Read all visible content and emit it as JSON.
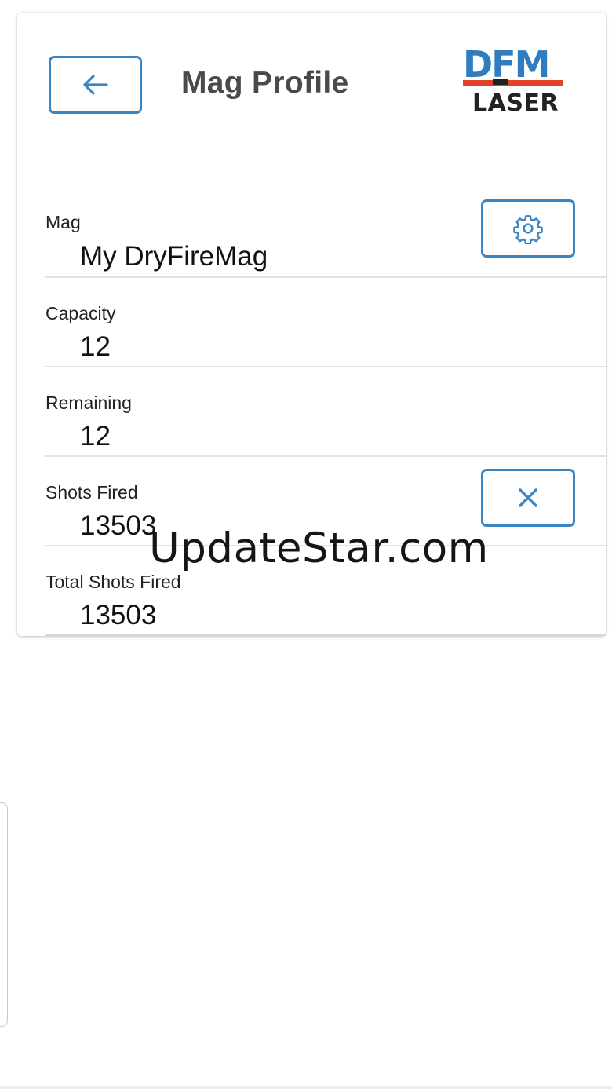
{
  "header": {
    "title": "Mag Profile",
    "back_icon": "arrow-left-icon"
  },
  "logo": {
    "text_top": "DFM",
    "text_bottom": "LASER",
    "colors": {
      "blue": "#2f7cc0",
      "red": "#e0432a",
      "dark": "#222222"
    }
  },
  "fields": {
    "mag": {
      "label": "Mag",
      "value": "My DryFireMag"
    },
    "capacity": {
      "label": "Capacity",
      "value": "12"
    },
    "remaining": {
      "label": "Remaining",
      "value": "12"
    },
    "shots_fired": {
      "label": "Shots Fired",
      "value": "13503"
    },
    "total_shots_fired": {
      "label": "Total Shots Fired",
      "value": "13503"
    }
  },
  "actions": {
    "settings_icon": "gear-icon",
    "reset_icon": "close-icon"
  },
  "watermark": "UpdateStar.com",
  "colors": {
    "accent": "#3a86c4",
    "title": "#4a4a4a",
    "divider": "#e2e2e2"
  }
}
